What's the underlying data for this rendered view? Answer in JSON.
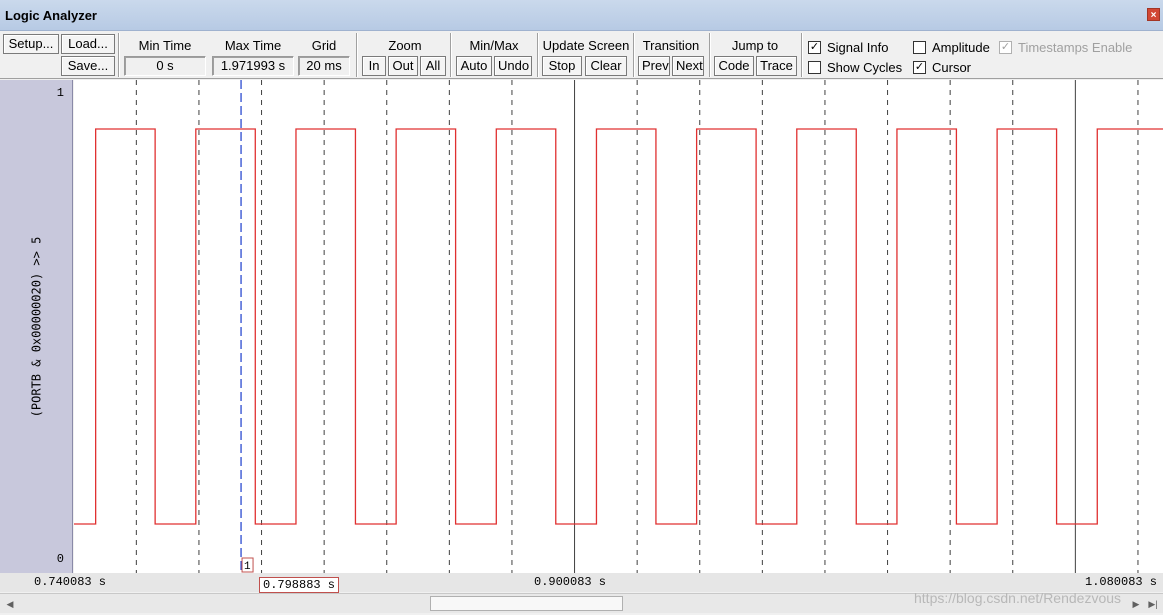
{
  "window": {
    "title": "Logic Analyzer",
    "close_glyph": "×"
  },
  "toolbar": {
    "setup": "Setup...",
    "load": "Load...",
    "save": "Save...",
    "min_time": {
      "label": "Min Time",
      "value": "0 s"
    },
    "max_time": {
      "label": "Max Time",
      "value": "1.971993 s"
    },
    "grid": {
      "label": "Grid",
      "value": "20 ms"
    },
    "zoom": {
      "label": "Zoom",
      "in": "In",
      "out": "Out",
      "all": "All"
    },
    "minmax": {
      "label": "Min/Max",
      "auto": "Auto",
      "undo": "Undo"
    },
    "update_screen": {
      "label": "Update Screen",
      "stop": "Stop",
      "clear": "Clear"
    },
    "transition": {
      "label": "Transition",
      "prev": "Prev",
      "next": "Next"
    },
    "jump_to": {
      "label": "Jump to",
      "code": "Code",
      "trace": "Trace"
    },
    "options": {
      "signal_info": {
        "label": "Signal Info",
        "checked": true
      },
      "amplitude": {
        "label": "Amplitude",
        "checked": false
      },
      "timestamps_enable": {
        "label": "Timestamps Enable",
        "checked": true,
        "disabled": true
      },
      "show_cycles": {
        "label": "Show Cycles",
        "checked": false
      },
      "cursor": {
        "label": "Cursor",
        "checked": true
      }
    },
    "check_glyph": "✓"
  },
  "signal": {
    "name": "(PORTB & 0x00000020) >> 5",
    "y_max_label": "1",
    "y_min_label": "0"
  },
  "cursor": {
    "marker": "1",
    "time": "0.798883 s"
  },
  "axis": {
    "left": "0.740083 s",
    "center": "0.900083 s",
    "right": "1.080083 s"
  },
  "watermark": "https://blog.csdn.net/Rendezvous",
  "colors": {
    "signal": "#e03030",
    "cursor": "#1a3ccc",
    "grid": "#404040"
  },
  "chart_data": {
    "type": "line",
    "step": true,
    "x_start": 0.740083,
    "x_end": 1.088,
    "grid_step": 0.02,
    "ylim": [
      0,
      1
    ],
    "transitions": [
      {
        "t": 0.747,
        "v": 1
      },
      {
        "t": 0.766,
        "v": 0
      },
      {
        "t": 0.779,
        "v": 1
      },
      {
        "t": 0.798,
        "v": 0
      },
      {
        "t": 0.811,
        "v": 1
      },
      {
        "t": 0.83,
        "v": 0
      },
      {
        "t": 0.843,
        "v": 1
      },
      {
        "t": 0.862,
        "v": 0
      },
      {
        "t": 0.875,
        "v": 1
      },
      {
        "t": 0.894,
        "v": 0
      },
      {
        "t": 0.907,
        "v": 1
      },
      {
        "t": 0.926,
        "v": 0
      },
      {
        "t": 0.939,
        "v": 1
      },
      {
        "t": 0.958,
        "v": 0
      },
      {
        "t": 0.971,
        "v": 1
      },
      {
        "t": 0.99,
        "v": 0
      },
      {
        "t": 1.003,
        "v": 1
      },
      {
        "t": 1.022,
        "v": 0
      },
      {
        "t": 1.035,
        "v": 1
      },
      {
        "t": 1.054,
        "v": 0
      },
      {
        "t": 1.067,
        "v": 1
      }
    ],
    "initial_value": 0,
    "cursor_time": 0.798883
  }
}
